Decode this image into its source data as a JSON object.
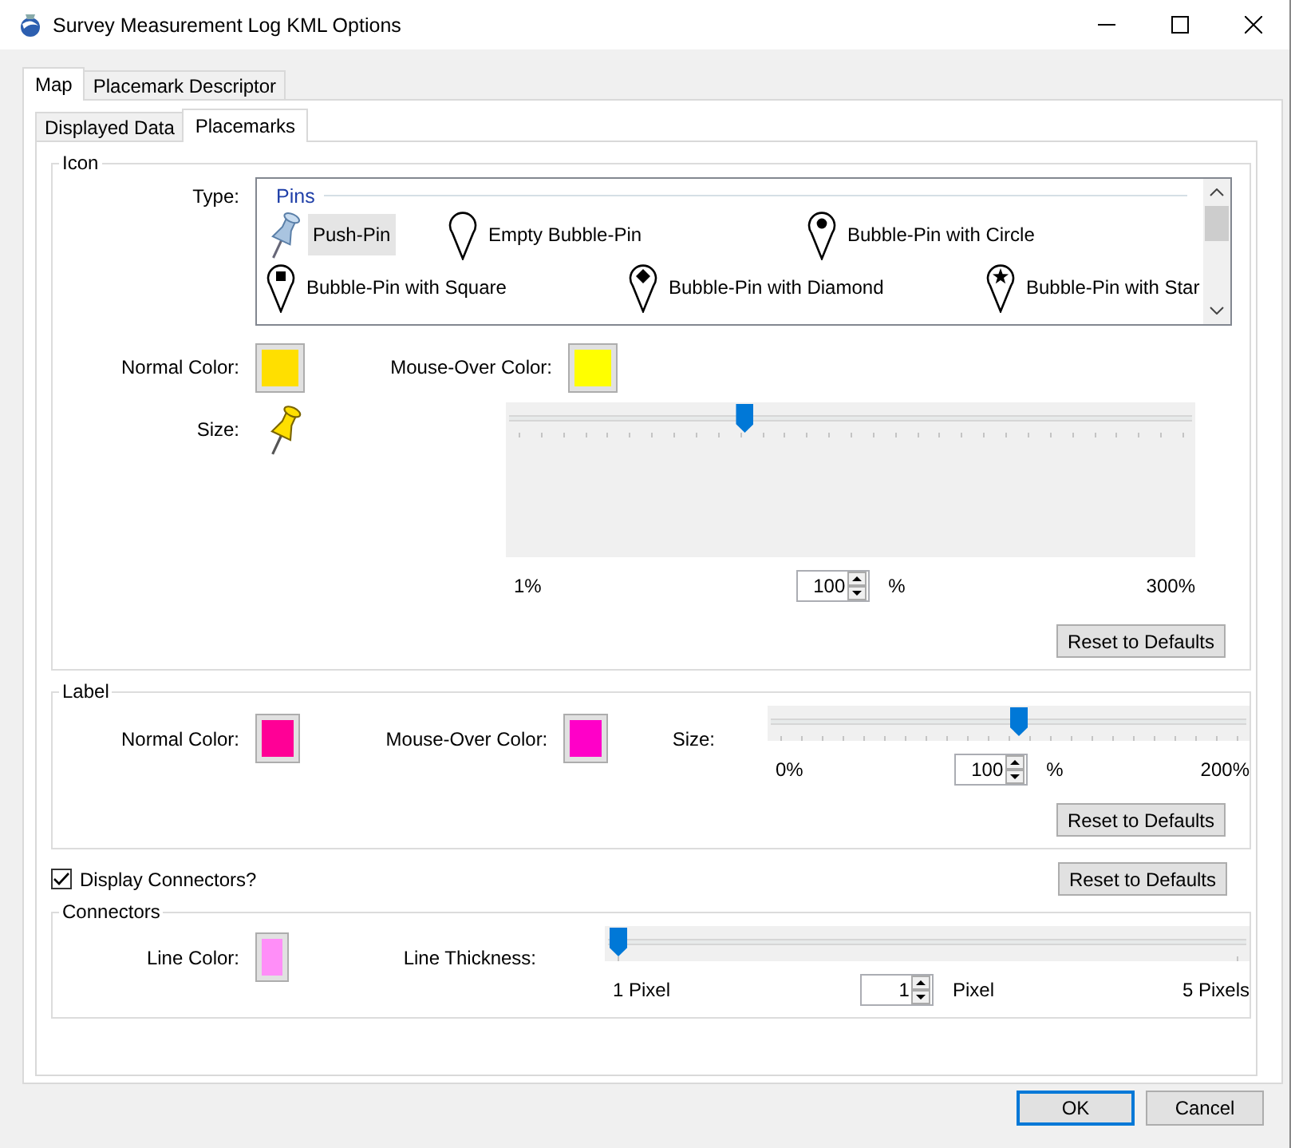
{
  "window": {
    "title": "Survey Measurement Log KML Options"
  },
  "tabs": [
    {
      "label": "Map",
      "selected": true
    },
    {
      "label": "Placemark Descriptor",
      "selected": false
    }
  ],
  "subtabs": [
    {
      "label": "Displayed Data",
      "selected": false
    },
    {
      "label": "Placemarks",
      "selected": true
    }
  ],
  "icon_group": {
    "title": "Icon",
    "type_label": "Type:",
    "list": {
      "header": "Pins",
      "rows": [
        [
          {
            "kind": "push-pin",
            "label": "Push-Pin",
            "selected": true
          },
          {
            "kind": "empty",
            "label": "Empty Bubble-Pin",
            "selected": false
          },
          {
            "kind": "circle",
            "label": "Bubble-Pin with Circle",
            "selected": false
          }
        ],
        [
          {
            "kind": "square",
            "label": "Bubble-Pin with Square",
            "selected": false
          },
          {
            "kind": "diamond",
            "label": "Bubble-Pin with Diamond",
            "selected": false
          },
          {
            "kind": "star",
            "label": "Bubble-Pin with Star",
            "selected": false
          }
        ]
      ]
    },
    "swatches": [
      {
        "label": "Normal Color:",
        "color": "#ffdf00"
      },
      {
        "label": "Mouse-Over Color:",
        "color": "#ffff00"
      }
    ],
    "size_label": "Size:",
    "slider": {
      "level": 0.33,
      "min_label": "1%",
      "value": "100",
      "unit": "%",
      "max_label": "300%"
    },
    "reset": "Reset to Defaults"
  },
  "label_group": {
    "title": "Label",
    "swatches": [
      {
        "label": "Normal Color:",
        "color": "#ff0096"
      },
      {
        "label": "Mouse-Over Color:",
        "color": "#ff00c8"
      }
    ],
    "size_label": "Size:",
    "slider": {
      "level": 0.5,
      "min_label": "0%",
      "value": "100",
      "unit": "%",
      "max_label": "200%"
    },
    "reset": "Reset to Defaults"
  },
  "display_connectors": {
    "label": "Display Connectors?",
    "checked": true,
    "reset": "Reset to Defaults"
  },
  "connectors_group": {
    "title": "Connectors",
    "swatches": [
      {
        "label": "Line Color:",
        "color": "#ff8ef8"
      }
    ],
    "thickness_label": "Line Thickness:",
    "slider": {
      "level": 0,
      "min_label": "1 Pixel",
      "value": "1",
      "unit": "Pixel",
      "max_label": "5 Pixels"
    }
  },
  "buttons": [
    {
      "label": "OK",
      "default": true
    },
    {
      "label": "Cancel",
      "default": false
    }
  ]
}
